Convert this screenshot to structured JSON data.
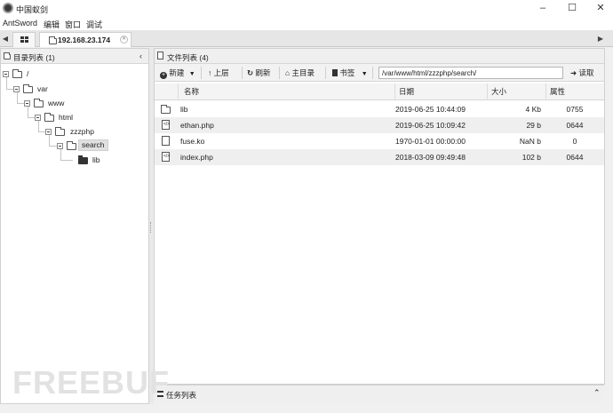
{
  "window": {
    "title": "中国蚁剑",
    "minimize": "–",
    "maximize": "☐",
    "close": "✕"
  },
  "menu": [
    "AntSword",
    "编辑",
    "窗口",
    "调试"
  ],
  "tabs": {
    "grid_icon": "grid-icon",
    "active_tab": "192.168.23.174"
  },
  "tree_panel": {
    "title": "目录列表 (1)",
    "nodes": [
      {
        "label": "/",
        "state": "open"
      },
      {
        "label": "var",
        "state": "open"
      },
      {
        "label": "www",
        "state": "open"
      },
      {
        "label": "html",
        "state": "open"
      },
      {
        "label": "zzzphp",
        "state": "open"
      },
      {
        "label": "search",
        "state": "selected"
      },
      {
        "label": "lib",
        "state": "closed"
      }
    ]
  },
  "file_panel": {
    "title": "文件列表 (4)",
    "toolbar": {
      "new": "新建",
      "up": "上层",
      "refresh": "刷新",
      "home": "主目录",
      "bookmark": "书签",
      "path": "/var/www/html/zzzphp/search/",
      "read": "读取"
    },
    "columns": [
      "名称",
      "日期",
      "大小",
      "属性"
    ],
    "rows": [
      {
        "icon": "folder-icon",
        "name": "lib",
        "date": "2019-06-25 10:44:09",
        "size": "4 Kb",
        "perm": "0755"
      },
      {
        "icon": "php-file-icon",
        "name": "ethan.php",
        "date": "2019-06-25 10:09:42",
        "size": "29 b",
        "perm": "0644"
      },
      {
        "icon": "file-icon",
        "name": "fuse.ko",
        "date": "1970-01-01 00:00:00",
        "size": "NaN b",
        "perm": "0"
      },
      {
        "icon": "php-file-icon",
        "name": "index.php",
        "date": "2018-03-09 09:49:48",
        "size": "102 b",
        "perm": "0644"
      }
    ]
  },
  "task_panel": {
    "title": "任务列表"
  },
  "watermark": "FREEBUF"
}
